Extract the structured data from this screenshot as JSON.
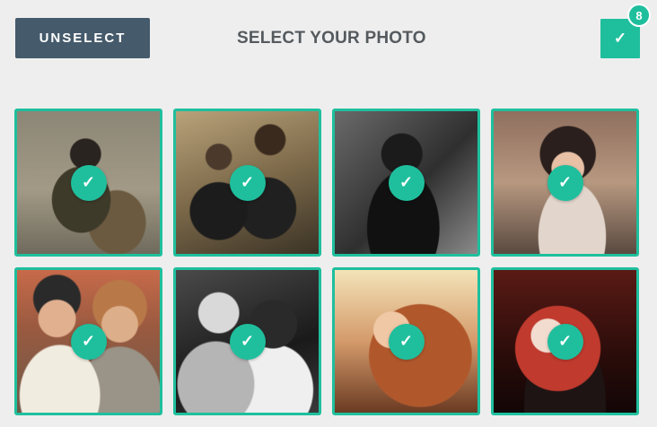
{
  "header": {
    "unselect_label": "UNSELECT",
    "title": "SELECT YOUR PHOTO",
    "confirm_icon": "✓",
    "selected_count": "8"
  },
  "accent_color": "#1fbf9d",
  "button_color": "#455a6b",
  "check_icon": "✓",
  "photos": [
    {
      "selected": true
    },
    {
      "selected": true
    },
    {
      "selected": true
    },
    {
      "selected": true
    },
    {
      "selected": true
    },
    {
      "selected": true
    },
    {
      "selected": true
    },
    {
      "selected": true
    }
  ]
}
